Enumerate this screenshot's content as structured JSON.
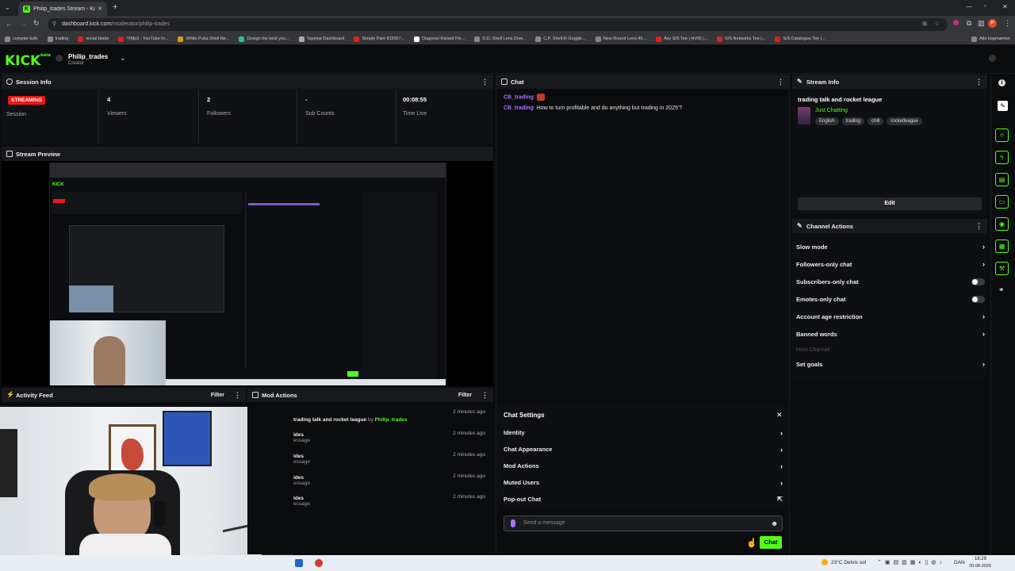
{
  "browser": {
    "tab_title": "Philip_trades Stream - Kick Da...",
    "new_tab": "+",
    "url_host": "dashboard.kick.com",
    "url_path": "/moderator/philip-trades",
    "bookmarks": [
      {
        "label": "compter kulb",
        "color": "#888"
      },
      {
        "label": "trading",
        "color": "#888"
      },
      {
        "label": "social blade",
        "color": "#e02020"
      },
      {
        "label": "YtMp3 - YouTube to...",
        "color": "#e02020"
      },
      {
        "label": "White Puka Shell Ne...",
        "color": "#d0a020"
      },
      {
        "label": "Design the best you...",
        "color": "#30c0a0"
      },
      {
        "label": "Topstep Dashboard",
        "color": "#aaa"
      },
      {
        "label": "Simple Pant IO2007...",
        "color": "#e02020"
      },
      {
        "label": "Diagonal Raised Fle...",
        "color": "#fff"
      },
      {
        "label": "D.D. Shell Lens Dow...",
        "color": "#888"
      },
      {
        "label": "C.P. Shell-R Goggle...",
        "color": "#888"
      },
      {
        "label": "New Round Lens 45...",
        "color": "#888"
      },
      {
        "label": "Axy S/S Tee | HVID |...",
        "color": "#e02020"
      },
      {
        "label": "S/S Networks Tee |...",
        "color": "#e02020"
      },
      {
        "label": "S/S Catalogue Tee |...",
        "color": "#e02020"
      },
      {
        "label": "Alle bogmærker",
        "color": "#888"
      }
    ]
  },
  "header": {
    "logo": "KICK",
    "logo_sup": "beta",
    "channel_name": "Philip_trades",
    "channel_role": "Creator"
  },
  "session": {
    "title": "Session Info",
    "status": "STREAMING",
    "status_label": "Session",
    "stats": [
      {
        "value": "4",
        "label": "Viewers"
      },
      {
        "value": "2",
        "label": "Followers"
      },
      {
        "value": "-",
        "label": "Sub Counts"
      },
      {
        "value": "00:08:55",
        "label": "Time Live"
      }
    ]
  },
  "preview": {
    "title": "Stream Preview"
  },
  "activity": {
    "title": "Activity Feed",
    "filter": "Filter"
  },
  "mod_actions": {
    "title": "Mod Actions",
    "filter": "Filter",
    "rows": [
      {
        "text": "trading talk and rocket league",
        "by": "by",
        "user": "Philip_trades",
        "time": "2 minutes ago"
      },
      {
        "text": "ides",
        "sub": "essage",
        "time": "2 minutes ago"
      },
      {
        "text": "ides",
        "sub": "essage",
        "time": "2 minutes ago"
      },
      {
        "text": "ides",
        "sub": "essage",
        "time": "2 minutes ago"
      },
      {
        "text": "ides",
        "sub": "essage",
        "time": "2 minutes ago"
      }
    ]
  },
  "chat": {
    "title": "Chat",
    "messages": [
      {
        "user": "CB_trading",
        "text": ""
      },
      {
        "user": "CB_trading",
        "text": "How to turn profitable and do anything but trading in 2025'?"
      }
    ],
    "settings_title": "Chat Settings",
    "settings": [
      "Identity",
      "Chat Appearance",
      "Mod Actions",
      "Muted Users",
      "Pop-out Chat"
    ],
    "input_placeholder": "Send a message",
    "send_label": "Chat"
  },
  "stream_info": {
    "title": "Stream Info",
    "stream_title": "trading talk and rocket league",
    "category": "Just Chatting",
    "tags": [
      "English",
      "trading",
      "chill",
      "rocketleague"
    ],
    "edit_label": "Edit"
  },
  "channel_actions": {
    "title": "Channel Actions",
    "items": [
      {
        "label": "Slow mode",
        "control": "chevron"
      },
      {
        "label": "Followers-only chat",
        "control": "chevron"
      },
      {
        "label": "Subscribers-only chat",
        "control": "toggle"
      },
      {
        "label": "Emotes-only chat",
        "control": "toggle"
      },
      {
        "label": "Account age restriction",
        "control": "chevron"
      },
      {
        "label": "Banned words",
        "control": "chevron"
      },
      {
        "label": "Host Channel",
        "control": "disabled"
      },
      {
        "label": "Set goals",
        "control": "chevron"
      }
    ]
  },
  "taskbar": {
    "weather": "23°C Delvis sol",
    "lang": "DAN",
    "time": "18:29",
    "date": "30-08-2025"
  },
  "colors": {
    "accent": "#53fc18",
    "live": "#e91916",
    "username": "#a970ff"
  }
}
